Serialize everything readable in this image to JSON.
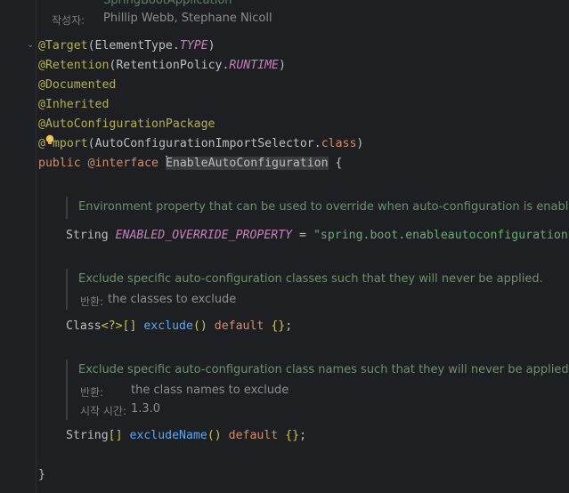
{
  "header_doc": {
    "cut_line": "SpringBootApplication",
    "author_label": "작성자:",
    "authors": "Phillip Webb, Stephane Nicoll"
  },
  "annotations": {
    "target": "@Target",
    "target_arg_class": "ElementType",
    "target_arg_const": "TYPE",
    "retention": "@Retention",
    "retention_arg_class": "RetentionPolicy",
    "retention_arg_const": "RUNTIME",
    "documented": "@Documented",
    "inherited": "@Inherited",
    "autoconfig_package": "@AutoConfigurationPackage",
    "import_at": "@",
    "import_rest": "mport",
    "import_arg": "AutoConfigurationImportSelector",
    "import_class_kw": "class"
  },
  "declaration": {
    "public_kw": "public",
    "interface_kw": "@interface",
    "name": "EnableAutoConfiguration",
    "open_brace": "{",
    "close_brace": "}"
  },
  "field1": {
    "doc": "Environment property that can be used to override when auto-configuration is enabled.",
    "type": "String",
    "name": "ENABLED_OVERRIDE_PROPERTY",
    "equals": "=",
    "value": "\"spring.boot.enableautoconfiguration\";"
  },
  "method1": {
    "doc": "Exclude specific auto-configuration classes such that they will never be applied.",
    "returns_label": "반환:",
    "returns_value": "the classes to exclude",
    "type": "Class",
    "generic": "<?>[]",
    "name": "exclude",
    "parens": "()",
    "default_kw": "default",
    "default_val": "{}",
    "semi": ";"
  },
  "method2": {
    "doc": "Exclude specific auto-configuration class names such that they will never be applied.",
    "returns_label": "반환:",
    "returns_value": "the class names to exclude",
    "since_label": "시작 시간:",
    "since_value": "1.3.0",
    "type": "String",
    "array": "[]",
    "name": "excludeName",
    "parens": "()",
    "default_kw": "default",
    "default_val": "{}",
    "semi": ";"
  },
  "icons": {
    "fold": "chevron-down-icon",
    "intention": "lightbulb-icon"
  }
}
